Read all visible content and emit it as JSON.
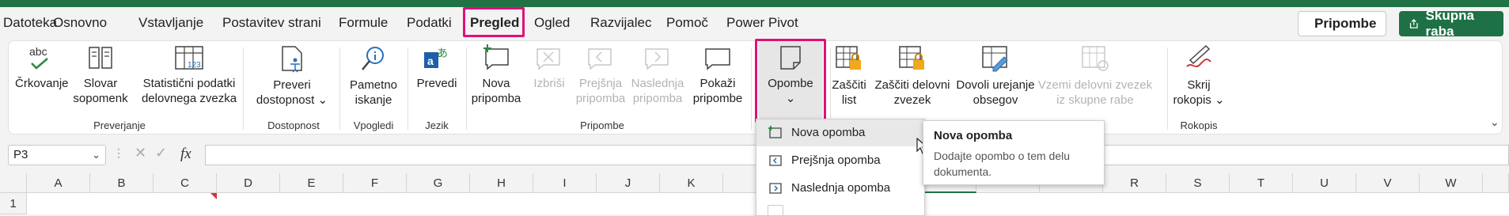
{
  "tabs": [
    "Datoteka",
    "Osnovno",
    "Vstavljanje",
    "Postavitev strani",
    "Formule",
    "Podatki",
    "Pregled",
    "Ogled",
    "Razvijalec",
    "Pomoč",
    "Power Pivot"
  ],
  "active_tab": "Pregled",
  "top_buttons": {
    "comments": "Pripombe",
    "share": "Skupna raba"
  },
  "ribbon": {
    "proofing": {
      "spelling": "Črkovanje",
      "thesaurus_1": "Slovar",
      "thesaurus_2": "sopomenk",
      "stats_1": "Statistični podatki",
      "stats_2": "delovnega zvezka",
      "group": "Preverjanje"
    },
    "accessibility": {
      "check_1": "Preveri",
      "check_2": "dostopnost",
      "group": "Dostopnost"
    },
    "insights": {
      "smart_1": "Pametno",
      "smart_2": "iskanje",
      "group": "Vpogledi"
    },
    "language": {
      "translate": "Prevedi",
      "group": "Jezik"
    },
    "comments": {
      "new_1": "Nova",
      "new_2": "pripomba",
      "delete": "Izbriši",
      "prev_1": "Prejšnja",
      "prev_2": "pripomba",
      "next_1": "Naslednja",
      "next_2": "pripomba",
      "show_1": "Pokaži",
      "show_2": "pripombe",
      "group": "Pripombe"
    },
    "notes": {
      "label": "Opombe"
    },
    "protect": {
      "sheet_1": "Zaščiti",
      "sheet_2": "list",
      "wb_1": "Zaščiti delovni",
      "wb_2": "zvezek",
      "ranges_1": "Dovoli urejanje",
      "ranges_2": "obsegov",
      "unshare_1": "Vzemi delovni zvezek",
      "unshare_2": "iz skupne rabe"
    },
    "ink": {
      "hide_1": "Skrij",
      "hide_2": "rokopis",
      "group": "Rokopis"
    }
  },
  "name_box": "P3",
  "fx_label": "fx",
  "columns": [
    "A",
    "B",
    "C",
    "D",
    "E",
    "F",
    "G",
    "H",
    "I",
    "J",
    "K",
    "",
    "",
    "",
    "R",
    "S",
    "T",
    "U",
    "V",
    "W"
  ],
  "row_label": "1",
  "dropdown": {
    "items": [
      "Nova opomba",
      "Prejšnja opomba",
      "Naslednja opomba"
    ]
  },
  "tooltip": {
    "title": "Nova opomba",
    "line1": "Dodajte opombo o tem delu",
    "line2": "dokumenta."
  },
  "colors": {
    "brand": "#217346",
    "highlight": "#e0107a"
  }
}
